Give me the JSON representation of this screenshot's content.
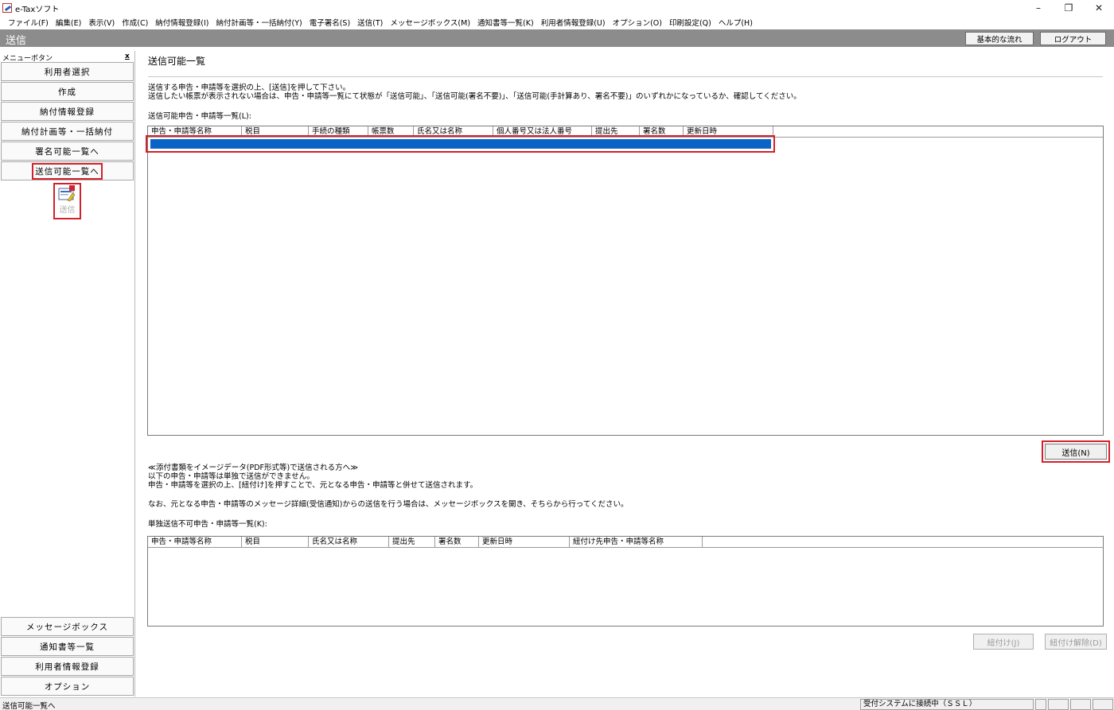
{
  "window": {
    "title": "e-Taxソフト",
    "controls": [
      "–",
      "❐",
      "✕"
    ]
  },
  "menu": [
    "ファイル(F)",
    "編集(E)",
    "表示(V)",
    "作成(C)",
    "納付情報登録(I)",
    "納付計画等・一括納付(Y)",
    "電子署名(S)",
    "送信(T)",
    "メッセージボックス(M)",
    "通知書等一覧(K)",
    "利用者情報登録(U)",
    "オプション(O)",
    "印刷設定(Q)",
    "ヘルプ(H)"
  ],
  "header": {
    "title": "送信",
    "flow_button": "基本的な流れ",
    "logout_button": "ログアウト"
  },
  "sidebar": {
    "heading": "メニューボタン",
    "close": "x",
    "top_items": [
      "利用者選択",
      "作成",
      "納付情報登録",
      "納付計画等・一括納付",
      "署名可能一覧へ",
      "送信可能一覧へ"
    ],
    "send_icon_label": "送信",
    "bottom_items": [
      "メッセージボックス",
      "通知書等一覧",
      "利用者情報登録",
      "オプション"
    ]
  },
  "main": {
    "title": "送信可能一覧",
    "instructions": [
      "送信する申告・申請等を選択の上、[送信]を押して下さい。",
      "送信したい帳票が表示されない場合は、申告・申請等一覧にて状態が「送信可能」、「送信可能(署名不要)」、「送信可能(手計算あり、署名不要)」のいずれかになっているか、確認してください。"
    ],
    "list1_label": "送信可能申告・申請等一覧(L):",
    "list1_columns": [
      "申告・申請等名称",
      "税目",
      "手続の種類",
      "帳票数",
      "氏名又は名称",
      "個人番号又は法人番号",
      "提出先",
      "署名数",
      "更新日時"
    ],
    "send_button": "送信(N)",
    "attach_notes": [
      "≪添付書類をイメージデータ(PDF形式等)で送信される方へ≫",
      "以下の申告・申請等は単独で送信ができません。",
      "申告・申請等を選択の上、[紐付け]を押すことで、元となる申告・申請等と併せて送信されます。"
    ],
    "message_note": "なお、元となる申告・申請等のメッセージ詳細(受信通知)からの送信を行う場合は、メッセージボックスを開き、そちらから行ってください。",
    "list2_label": "単独送信不可申告・申請等一覧(K):",
    "list2_columns": [
      "申告・申請等名称",
      "税目",
      "氏名又は名称",
      "提出先",
      "署名数",
      "更新日時",
      "紐付け先申告・申請等名称"
    ],
    "link_button": "紐付け(J)",
    "unlink_button": "紐付け解除(D)"
  },
  "status": {
    "left": "送信可能一覧へ",
    "connection": "受付システムに接続中（ＳＳＬ）"
  },
  "colors": {
    "header_gray": "#8c8c8c",
    "selection_blue": "#0a64c8",
    "highlight_red": "#d4202a"
  }
}
